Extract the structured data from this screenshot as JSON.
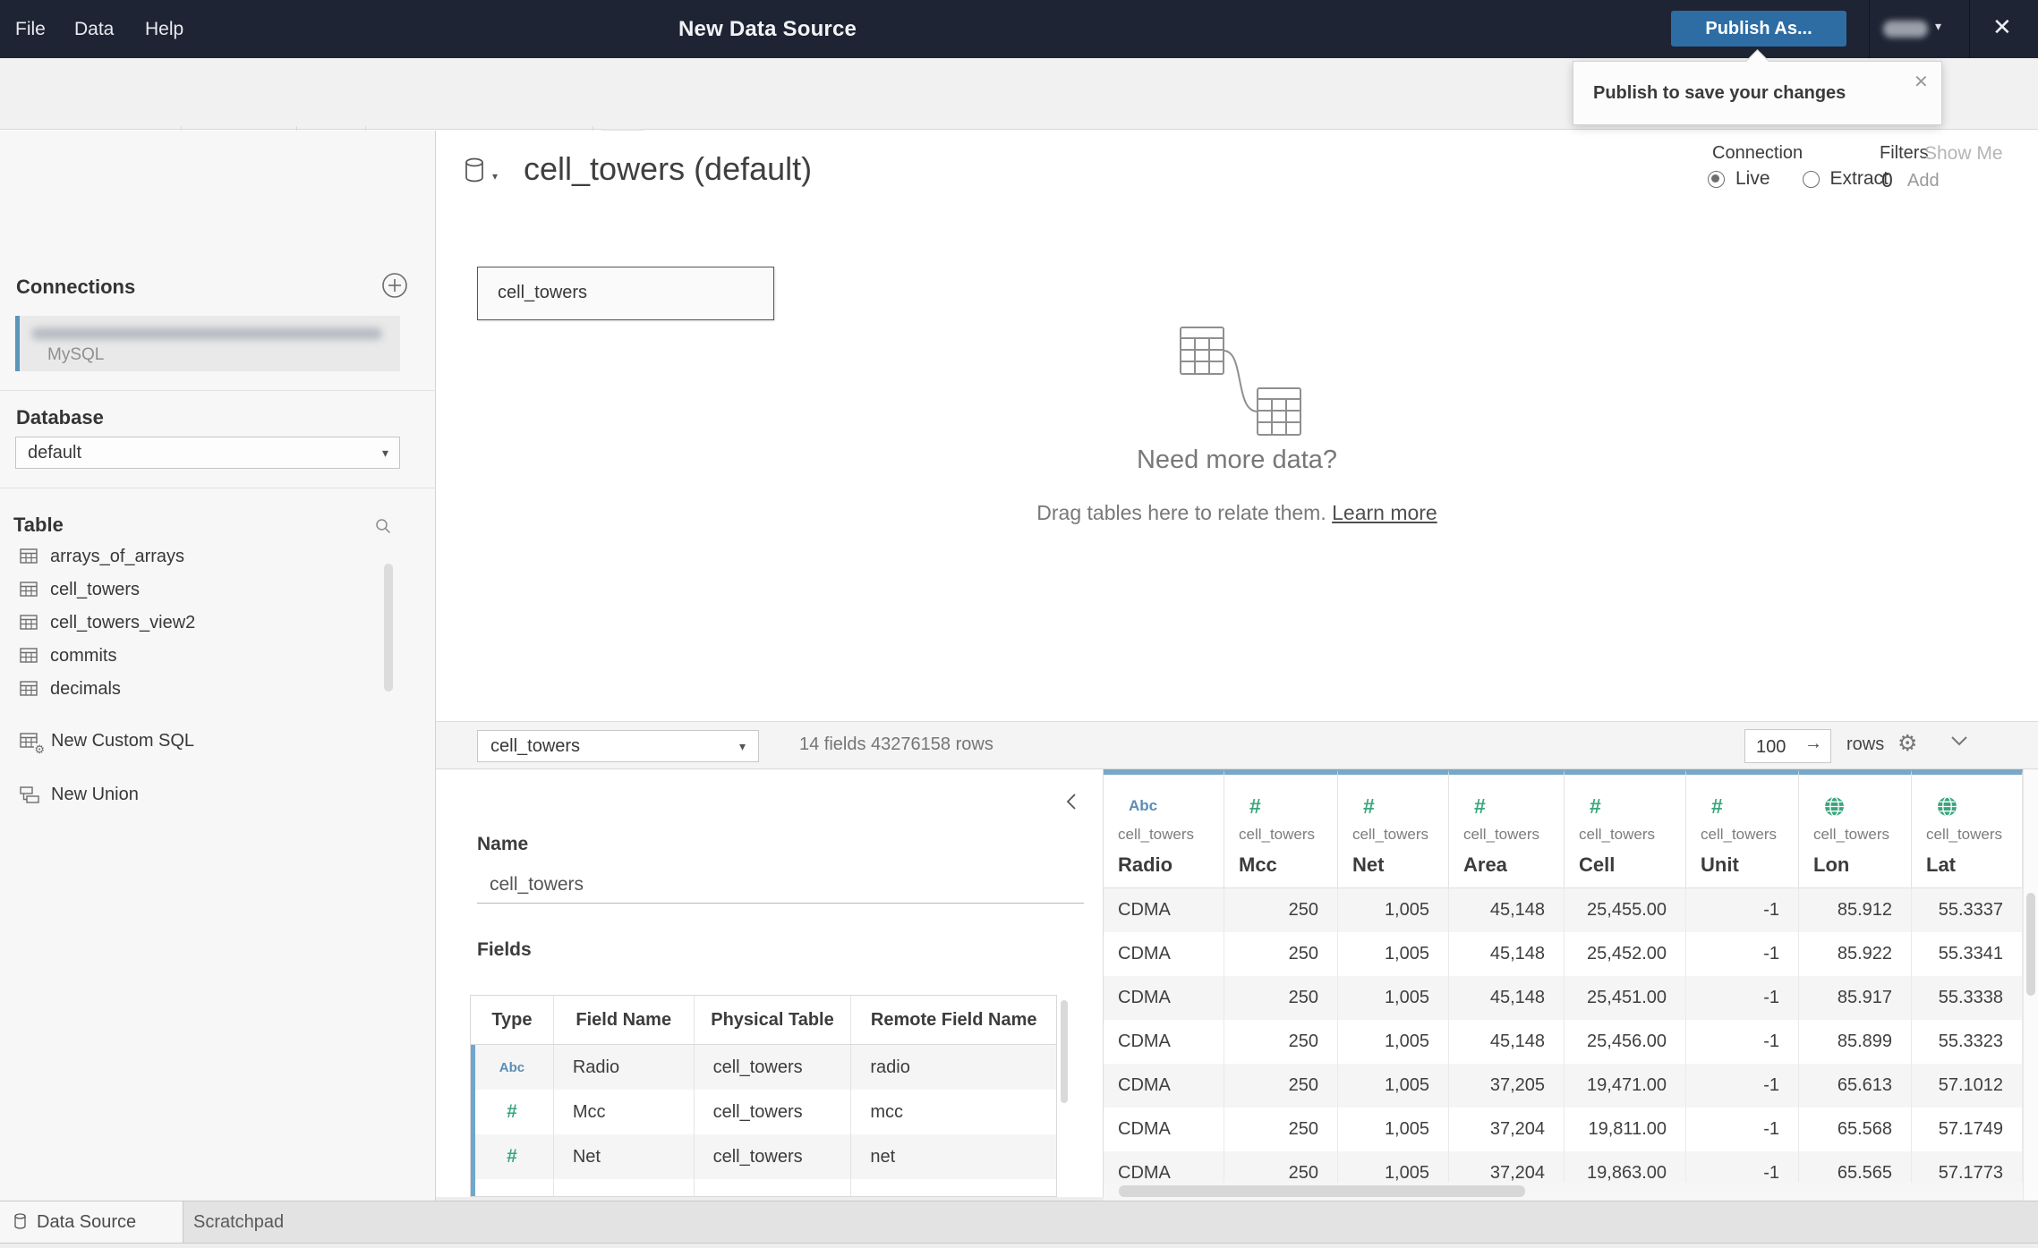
{
  "window": {
    "menus": [
      "File",
      "Data",
      "Help"
    ],
    "title": "New Data Source",
    "publish_button": "Publish As...",
    "show_me": "Show Me"
  },
  "tooltip": {
    "text": "Publish to save your changes"
  },
  "sidebar": {
    "connections_header": "Connections",
    "connection": {
      "type": "MySQL"
    },
    "database_header": "Database",
    "database_value": "default",
    "table_header": "Table",
    "tables": [
      "arrays_of_arrays",
      "cell_towers",
      "cell_towers_view2",
      "commits",
      "decimals"
    ],
    "actions": [
      {
        "label": "New Custom SQL",
        "icon": "table-gear-icon"
      },
      {
        "label": "New Union",
        "icon": "union-icon"
      }
    ]
  },
  "canvas": {
    "datasource_title": "cell_towers (default)",
    "node_label": "cell_towers",
    "connection_label": "Connection",
    "connection_options": [
      {
        "label": "Live",
        "selected": true
      },
      {
        "label": "Extract",
        "selected": false
      }
    ],
    "filters_label": "Filters",
    "filters_count": "0",
    "filters_add": "Add",
    "empty_heading": "Need more data?",
    "empty_body": "Drag tables here to relate them. ",
    "empty_link": "Learn more"
  },
  "preview_bar": {
    "table_selector": "cell_towers",
    "summary": "14 fields 43276158 rows",
    "row_count": "100",
    "rows_label": "rows"
  },
  "detail": {
    "name_label": "Name",
    "name_value": "cell_towers",
    "fields_label": "Fields",
    "fields_headers": [
      "Type",
      "Field Name",
      "Physical Table",
      "Remote Field Name"
    ],
    "fields_rows": [
      {
        "type": "Abc",
        "field": "Radio",
        "table": "cell_towers",
        "remote": "radio"
      },
      {
        "type": "#",
        "field": "Mcc",
        "table": "cell_towers",
        "remote": "mcc"
      },
      {
        "type": "#",
        "field": "Net",
        "table": "cell_towers",
        "remote": "net"
      }
    ]
  },
  "grid": {
    "columns": [
      {
        "type": "Abc",
        "table": "cell_towers",
        "field": "Radio",
        "align": "left"
      },
      {
        "type": "#",
        "table": "cell_towers",
        "field": "Mcc",
        "align": "right"
      },
      {
        "type": "#",
        "table": "cell_towers",
        "field": "Net",
        "align": "right"
      },
      {
        "type": "#",
        "table": "cell_towers",
        "field": "Area",
        "align": "right"
      },
      {
        "type": "#",
        "table": "cell_towers",
        "field": "Cell",
        "align": "right"
      },
      {
        "type": "#",
        "table": "cell_towers",
        "field": "Unit",
        "align": "right"
      },
      {
        "type": "globe",
        "table": "cell_towers",
        "field": "Lon",
        "align": "right"
      },
      {
        "type": "globe",
        "table": "cell_towers",
        "field": "Lat",
        "align": "right"
      }
    ],
    "rows": [
      [
        "CDMA",
        "250",
        "1,005",
        "45,148",
        "25,455.00",
        "-1",
        "85.912",
        "55.3337"
      ],
      [
        "CDMA",
        "250",
        "1,005",
        "45,148",
        "25,452.00",
        "-1",
        "85.922",
        "55.3341"
      ],
      [
        "CDMA",
        "250",
        "1,005",
        "45,148",
        "25,451.00",
        "-1",
        "85.917",
        "55.3338"
      ],
      [
        "CDMA",
        "250",
        "1,005",
        "45,148",
        "25,456.00",
        "-1",
        "85.899",
        "55.3323"
      ],
      [
        "CDMA",
        "250",
        "1,005",
        "37,205",
        "19,471.00",
        "-1",
        "65.613",
        "57.1012"
      ],
      [
        "CDMA",
        "250",
        "1,005",
        "37,204",
        "19,811.00",
        "-1",
        "65.568",
        "57.1749"
      ],
      [
        "CDMA",
        "250",
        "1,005",
        "37,204",
        "19,863.00",
        "-1",
        "65.565",
        "57.1773"
      ]
    ]
  },
  "statusbar": {
    "tabs": [
      "Data Source",
      "Scratchpad"
    ]
  },
  "colors": {
    "topbar": "#1e2433",
    "publish_blue": "#2e6da3",
    "connection_accent": "#5a95ba",
    "type_green": "#3aa67d",
    "type_blue": "#5b8db5",
    "grid_header_accent": "#78a8c8"
  }
}
